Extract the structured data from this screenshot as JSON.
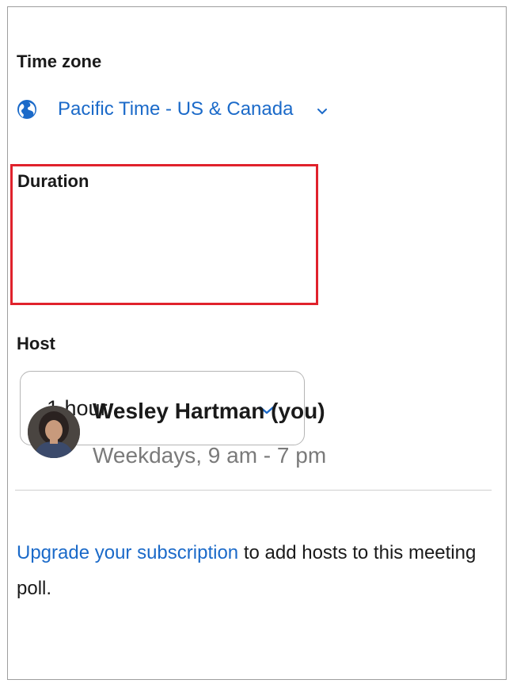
{
  "time_zone": {
    "label": "Time zone",
    "value": "Pacific Time - US & Canada",
    "icon": "globe-icon",
    "accent_color": "#1b6ac9"
  },
  "duration": {
    "label": "Duration",
    "value": "1 hour",
    "highlight_color": "#e0222c"
  },
  "host": {
    "label": "Host",
    "name": "Wesley Hartman (you)",
    "hours": "Weekdays, 9 am - 7 pm"
  },
  "upgrade": {
    "link_text": "Upgrade your subscription",
    "rest_text": " to add hosts to this meeting poll."
  }
}
